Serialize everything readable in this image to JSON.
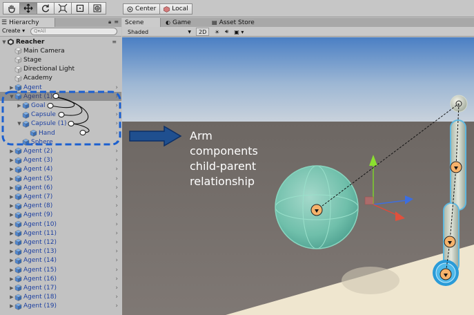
{
  "toolbar": {
    "tools": [
      {
        "icon": "hand-icon",
        "active": false
      },
      {
        "icon": "move-icon",
        "active": true
      },
      {
        "icon": "rotate-icon",
        "active": false
      },
      {
        "icon": "scale-icon",
        "active": false
      },
      {
        "icon": "rect-tool-icon",
        "active": false
      },
      {
        "icon": "transform-tool-icon",
        "active": false
      }
    ],
    "pivot_label": "Center",
    "space_label": "Local"
  },
  "hierarchy": {
    "tab_label": "Hierarchy",
    "create_label": "Create ▾",
    "search_placeholder": "Q▾All",
    "rows": [
      {
        "label": "Reacher",
        "indent": 0,
        "fold": "▼",
        "kind": "scene"
      },
      {
        "label": "Main Camera",
        "indent": 1,
        "fold": "",
        "kind": "object"
      },
      {
        "label": "Stage",
        "indent": 1,
        "fold": "",
        "kind": "object"
      },
      {
        "label": "Directional Light",
        "indent": 1,
        "fold": "",
        "kind": "object"
      },
      {
        "label": "Academy",
        "indent": 1,
        "fold": "",
        "kind": "object"
      },
      {
        "label": "Agent",
        "indent": 1,
        "fold": "▶",
        "kind": "prefab"
      },
      {
        "label": "Agent (1)",
        "indent": 1,
        "fold": "▼",
        "kind": "prefab-selected"
      },
      {
        "label": "Goal",
        "indent": 2,
        "fold": "▶",
        "kind": "prefab"
      },
      {
        "label": "Capsule",
        "indent": 2,
        "fold": "",
        "kind": "prefab"
      },
      {
        "label": "Capsule (1)",
        "indent": 2,
        "fold": "▼",
        "kind": "prefab"
      },
      {
        "label": "Hand",
        "indent": 3,
        "fold": "",
        "kind": "prefab"
      },
      {
        "label": "Sphere",
        "indent": 2,
        "fold": "",
        "kind": "prefab"
      },
      {
        "label": "Agent (2)",
        "indent": 1,
        "fold": "▶",
        "kind": "prefab"
      },
      {
        "label": "Agent (3)",
        "indent": 1,
        "fold": "▶",
        "kind": "prefab"
      },
      {
        "label": "Agent (4)",
        "indent": 1,
        "fold": "▶",
        "kind": "prefab"
      },
      {
        "label": "Agent (5)",
        "indent": 1,
        "fold": "▶",
        "kind": "prefab"
      },
      {
        "label": "Agent (6)",
        "indent": 1,
        "fold": "▶",
        "kind": "prefab"
      },
      {
        "label": "Agent (7)",
        "indent": 1,
        "fold": "▶",
        "kind": "prefab"
      },
      {
        "label": "Agent (8)",
        "indent": 1,
        "fold": "▶",
        "kind": "prefab"
      },
      {
        "label": "Agent (9)",
        "indent": 1,
        "fold": "▶",
        "kind": "prefab"
      },
      {
        "label": "Agent (10)",
        "indent": 1,
        "fold": "▶",
        "kind": "prefab"
      },
      {
        "label": "Agent (11)",
        "indent": 1,
        "fold": "▶",
        "kind": "prefab"
      },
      {
        "label": "Agent (12)",
        "indent": 1,
        "fold": "▶",
        "kind": "prefab"
      },
      {
        "label": "Agent (13)",
        "indent": 1,
        "fold": "▶",
        "kind": "prefab"
      },
      {
        "label": "Agent (14)",
        "indent": 1,
        "fold": "▶",
        "kind": "prefab"
      },
      {
        "label": "Agent (15)",
        "indent": 1,
        "fold": "▶",
        "kind": "prefab"
      },
      {
        "label": "Agent (16)",
        "indent": 1,
        "fold": "▶",
        "kind": "prefab"
      },
      {
        "label": "Agent (17)",
        "indent": 1,
        "fold": "▶",
        "kind": "prefab"
      },
      {
        "label": "Agent (18)",
        "indent": 1,
        "fold": "▶",
        "kind": "prefab"
      },
      {
        "label": "Agent (19)",
        "indent": 1,
        "fold": "▶",
        "kind": "prefab"
      }
    ]
  },
  "scene": {
    "tabs": [
      {
        "label": "Scene",
        "icon": "scene-icon",
        "active": true
      },
      {
        "label": "Game",
        "icon": "game-icon",
        "active": false
      },
      {
        "label": "Asset Store",
        "icon": "asset-store-icon",
        "active": false
      }
    ],
    "shading_mode": "Shaded",
    "toggle_2d": "2D"
  },
  "annotation": {
    "lines": [
      "Arm",
      "components",
      "child-parent",
      "relationship"
    ],
    "highlight_color": "#1a5fd0",
    "arrow_color": "#1f4f8f"
  },
  "colors": {
    "prefab_text": "#1c3fa0",
    "sphere_fill": "#6fc6b0",
    "joint_marker": "#f5b26b",
    "floor": "#efe6cf",
    "sky_top": "#4a7fc4",
    "ground": "#7a7470"
  }
}
